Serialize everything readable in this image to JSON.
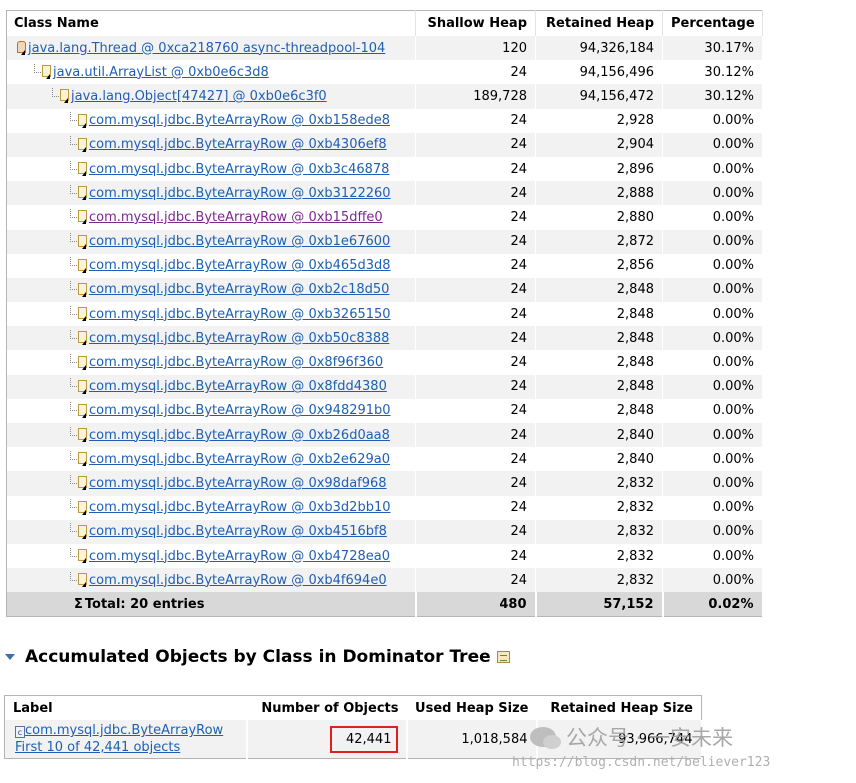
{
  "tree": {
    "headers": {
      "name": "Class Name",
      "shallow": "Shallow Heap",
      "retained": "Retained Heap",
      "percentage": "Percentage"
    },
    "rows": [
      {
        "name": "java.lang.Thread @ 0xca218760 async-threadpool-104",
        "shallow": "120",
        "retained": "94,326,184",
        "percentage": "30.17%",
        "icon": "thread-icon"
      },
      {
        "name": "java.util.ArrayList @ 0xb0e6c3d8",
        "shallow": "24",
        "retained": "94,156,496",
        "percentage": "30.12%",
        "icon": "object-icon"
      },
      {
        "name": "java.lang.Object[47427] @ 0xb0e6c3f0",
        "shallow": "189,728",
        "retained": "94,156,472",
        "percentage": "30.12%",
        "icon": "array-icon"
      },
      {
        "name": "com.mysql.jdbc.ByteArrayRow @ 0xb158ede8",
        "shallow": "24",
        "retained": "2,928",
        "percentage": "0.00%",
        "icon": "object-icon"
      },
      {
        "name": "com.mysql.jdbc.ByteArrayRow @ 0xb4306ef8",
        "shallow": "24",
        "retained": "2,904",
        "percentage": "0.00%",
        "icon": "object-icon"
      },
      {
        "name": "com.mysql.jdbc.ByteArrayRow @ 0xb3c46878",
        "shallow": "24",
        "retained": "2,896",
        "percentage": "0.00%",
        "icon": "object-icon"
      },
      {
        "name": "com.mysql.jdbc.ByteArrayRow @ 0xb3122260",
        "shallow": "24",
        "retained": "2,888",
        "percentage": "0.00%",
        "icon": "object-icon"
      },
      {
        "name": "com.mysql.jdbc.ByteArrayRow @ 0xb15dffe0",
        "shallow": "24",
        "retained": "2,880",
        "percentage": "0.00%",
        "icon": "object-icon",
        "visited": true
      },
      {
        "name": "com.mysql.jdbc.ByteArrayRow @ 0xb1e67600",
        "shallow": "24",
        "retained": "2,872",
        "percentage": "0.00%",
        "icon": "object-icon"
      },
      {
        "name": "com.mysql.jdbc.ByteArrayRow @ 0xb465d3d8",
        "shallow": "24",
        "retained": "2,856",
        "percentage": "0.00%",
        "icon": "object-icon"
      },
      {
        "name": "com.mysql.jdbc.ByteArrayRow @ 0xb2c18d50",
        "shallow": "24",
        "retained": "2,848",
        "percentage": "0.00%",
        "icon": "object-icon"
      },
      {
        "name": "com.mysql.jdbc.ByteArrayRow @ 0xb3265150",
        "shallow": "24",
        "retained": "2,848",
        "percentage": "0.00%",
        "icon": "object-icon"
      },
      {
        "name": "com.mysql.jdbc.ByteArrayRow @ 0xb50c8388",
        "shallow": "24",
        "retained": "2,848",
        "percentage": "0.00%",
        "icon": "object-icon"
      },
      {
        "name": "com.mysql.jdbc.ByteArrayRow @ 0x8f96f360",
        "shallow": "24",
        "retained": "2,848",
        "percentage": "0.00%",
        "icon": "object-icon"
      },
      {
        "name": "com.mysql.jdbc.ByteArrayRow @ 0x8fdd4380",
        "shallow": "24",
        "retained": "2,848",
        "percentage": "0.00%",
        "icon": "object-icon"
      },
      {
        "name": "com.mysql.jdbc.ByteArrayRow @ 0x948291b0",
        "shallow": "24",
        "retained": "2,848",
        "percentage": "0.00%",
        "icon": "object-icon"
      },
      {
        "name": "com.mysql.jdbc.ByteArrayRow @ 0xb26d0aa8",
        "shallow": "24",
        "retained": "2,840",
        "percentage": "0.00%",
        "icon": "object-icon"
      },
      {
        "name": "com.mysql.jdbc.ByteArrayRow @ 0xb2e629a0",
        "shallow": "24",
        "retained": "2,840",
        "percentage": "0.00%",
        "icon": "object-icon"
      },
      {
        "name": "com.mysql.jdbc.ByteArrayRow @ 0x98daf968",
        "shallow": "24",
        "retained": "2,832",
        "percentage": "0.00%",
        "icon": "object-icon"
      },
      {
        "name": "com.mysql.jdbc.ByteArrayRow @ 0xb3d2bb10",
        "shallow": "24",
        "retained": "2,832",
        "percentage": "0.00%",
        "icon": "object-icon"
      },
      {
        "name": "com.mysql.jdbc.ByteArrayRow @ 0xb4516bf8",
        "shallow": "24",
        "retained": "2,832",
        "percentage": "0.00%",
        "icon": "object-icon"
      },
      {
        "name": "com.mysql.jdbc.ByteArrayRow @ 0xb4728ea0",
        "shallow": "24",
        "retained": "2,832",
        "percentage": "0.00%",
        "icon": "object-icon"
      },
      {
        "name": "com.mysql.jdbc.ByteArrayRow @ 0xb4f694e0",
        "shallow": "24",
        "retained": "2,832",
        "percentage": "0.00%",
        "icon": "object-icon"
      }
    ],
    "total": {
      "symbol": "Σ",
      "label": "Total: 20 entries",
      "shallow": "480",
      "retained": "57,152",
      "percentage": "0.02%"
    }
  },
  "section": {
    "title": "Accumulated Objects by Class in Dominator Tree",
    "toggle_icon": "triangle-down-icon",
    "export_icon": "csv-export-icon"
  },
  "accumulated": {
    "headers": {
      "label": "Label",
      "count": "Number of Objects",
      "used": "Used Heap Size",
      "retained": "Retained Heap Size"
    },
    "row": {
      "class_icon_glyph": "c",
      "class_name": "com.mysql.jdbc.ByteArrayRow",
      "first_link": "First 10 of 42,441 objects",
      "count": "42,441",
      "used": "1,018,584",
      "retained": "93,966,744"
    }
  },
  "watermark": {
    "channel": "公众号 · 一安未来",
    "url": "https://blog.csdn.net/believer123"
  },
  "colors": {
    "link": "#1f5fb3",
    "visited_link": "#7a2a8a",
    "highlight_border": "#e02020"
  }
}
